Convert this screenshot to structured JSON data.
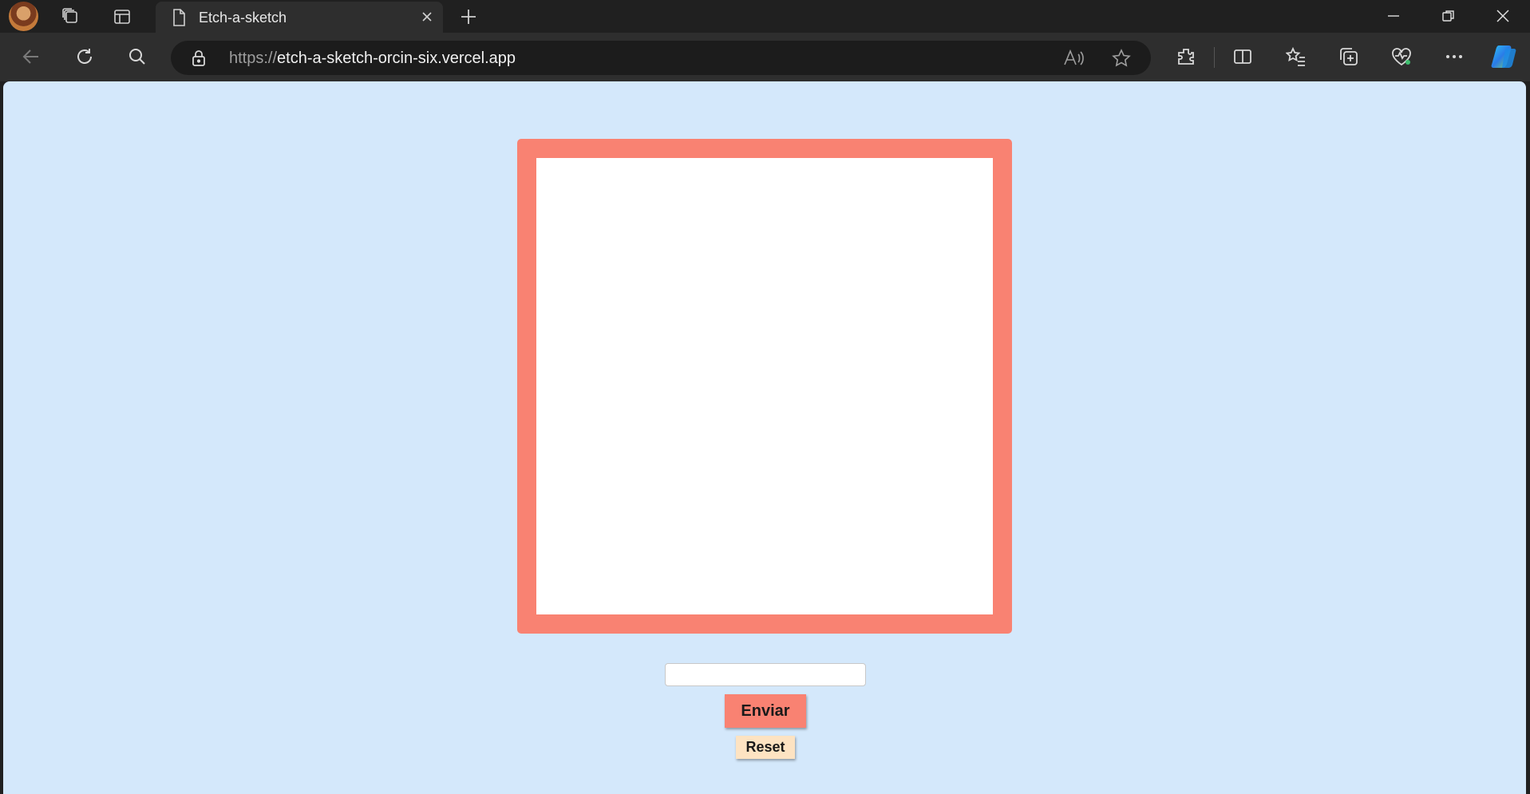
{
  "browser": {
    "tab": {
      "title": "Etch-a-sketch"
    },
    "address": {
      "scheme": "https://",
      "host": "etch-a-sketch-orcin-six.vercel.app"
    },
    "icons": [
      "profile-avatar",
      "workspaces-icon",
      "tab-actions-icon",
      "page-icon",
      "close-tab-icon",
      "new-tab-icon",
      "minimize-icon",
      "restore-icon",
      "close-window-icon",
      "back-icon",
      "refresh-icon",
      "search-icon",
      "lock-icon",
      "read-aloud-icon",
      "favorite-star-icon",
      "extensions-icon",
      "split-screen-icon",
      "favorites-icon",
      "collections-icon",
      "browser-essentials-icon",
      "more-icon",
      "copilot-icon"
    ]
  },
  "page": {
    "colors": {
      "background": "#d4e8fb",
      "frame": "#f98272",
      "board": "#ffffff",
      "reset_button": "#fde3c2"
    },
    "grid_input": {
      "value": "",
      "placeholder": ""
    },
    "submit_label": "Enviar",
    "reset_label": "Reset"
  }
}
